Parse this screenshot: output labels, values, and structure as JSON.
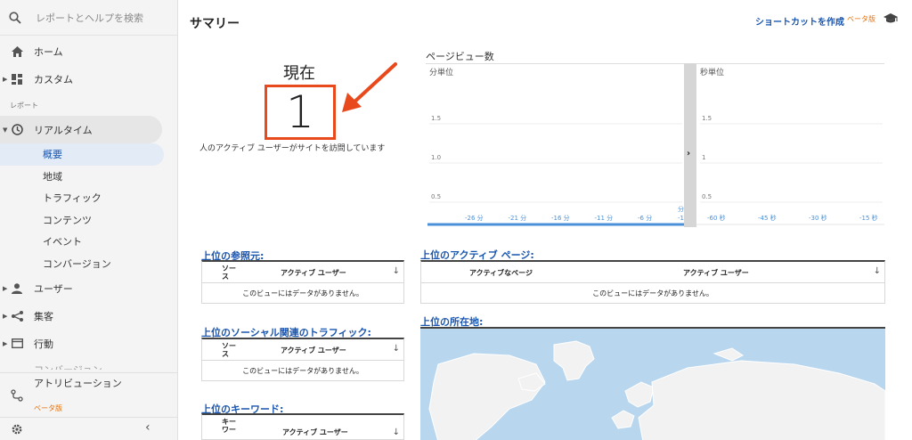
{
  "sidebar": {
    "search_placeholder": "レポートとヘルプを検索",
    "home": "ホーム",
    "custom": "カスタム",
    "reports_section": "レポート",
    "realtime": "リアルタイム",
    "realtime_items": [
      "概要",
      "地域",
      "トラフィック",
      "コンテンツ",
      "イベント",
      "コンバージョン"
    ],
    "user": "ユーザー",
    "acquisition": "集客",
    "behavior": "行動",
    "conversion_partial": "コンバージョン",
    "attribution": "アトリビューション",
    "attribution_beta": "ベータ版"
  },
  "header": {
    "title": "サマリー",
    "shortcut": "ショートカットを作成",
    "beta": "ベータ版"
  },
  "now": {
    "label": "現在",
    "value": "1",
    "description": "人のアクティブ ユーザーがサイトを訪問しています"
  },
  "pageviews": {
    "title": "ページビュー数",
    "left_label": "分単位",
    "right_label": "秒単位",
    "left_axis_edge": "分"
  },
  "chart_data": {
    "type": "bar",
    "title": "ページビュー数",
    "panels": [
      {
        "name": "分単位",
        "y_ticks": [
          "1.5",
          "1.0",
          "0.5"
        ],
        "x_ticks": [
          "-26 分",
          "-21 分",
          "-16 分",
          "-11 分",
          "-6 分",
          "-1"
        ],
        "ylim": [
          0,
          2
        ],
        "values": []
      },
      {
        "name": "秒単位",
        "y_ticks": [
          "1.5",
          "1",
          "0.5"
        ],
        "x_ticks": [
          "-60 秒",
          "-45 秒",
          "-30 秒",
          "-15 秒"
        ],
        "ylim": [
          0,
          2
        ],
        "values": []
      }
    ]
  },
  "referrers": {
    "title": "上位の参照元:",
    "col1": "ソー ス",
    "col2": "アクティブ ユーザー",
    "empty": "このビューにはデータがありません。"
  },
  "social": {
    "title": "上位のソーシャル関連のトラフィック:",
    "col1": "ソー ス",
    "col2": "アクティブ ユーザー",
    "empty": "このビューにはデータがありません。"
  },
  "keywords": {
    "title": "上位のキーワード:",
    "col1": "キー ワー",
    "col2": "アクティブ ユーザー"
  },
  "active_pages": {
    "title": "上位のアクティブ ページ:",
    "col1": "アクティブなページ",
    "col2": "アクティブ ユーザー",
    "empty": "このビューにはデータがありません。"
  },
  "locations": {
    "title": "上位の所在地:"
  },
  "icons": {
    "search": "search-icon",
    "home": "home-icon",
    "custom": "dashboard-icon",
    "realtime": "clock-icon",
    "user": "person-icon",
    "acquisition": "share-icon",
    "behavior": "window-icon",
    "attribution": "attribution-icon",
    "settings": "gear-icon",
    "collapse": "chevron-left-icon",
    "tutorial": "graduation-cap-icon"
  },
  "colors": {
    "accent": "#1a56b0",
    "highlight": "#e8491d",
    "beta": "#e8710a",
    "chart_line": "#4a90d9"
  }
}
